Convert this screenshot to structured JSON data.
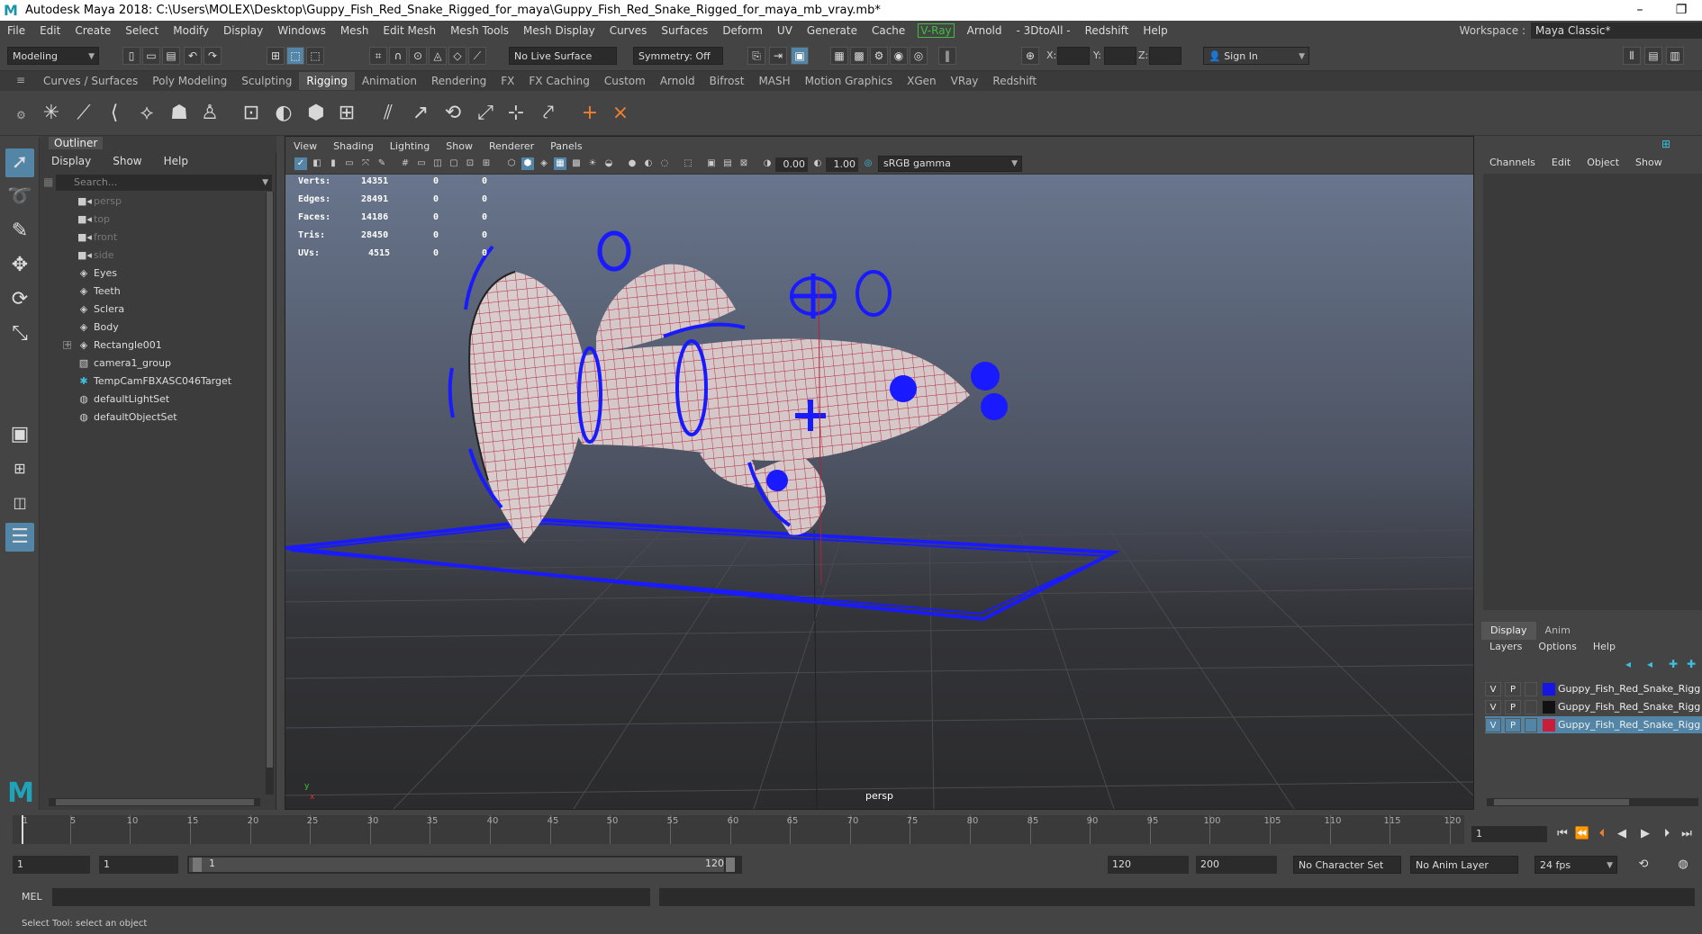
{
  "title": "Autodesk Maya 2018: C:\\Users\\MOLEX\\Desktop\\Guppy_Fish_Red_Snake_Rigged_for_maya\\Guppy_Fish_Red_Snake_Rigged_for_maya_mb_vray.mb*",
  "menus": [
    "File",
    "Edit",
    "Create",
    "Select",
    "Modify",
    "Display",
    "Windows",
    "Mesh",
    "Edit Mesh",
    "Mesh Tools",
    "Mesh Display",
    "Curves",
    "Surfaces",
    "Deform",
    "UV",
    "Generate",
    "Cache",
    "V-Ray",
    "Arnold",
    "- 3DtoAll -",
    "Redshift",
    "Help"
  ],
  "workspace": {
    "label": "Workspace :",
    "value": "Maya Classic*"
  },
  "status": {
    "mode": "Modeling",
    "live_surface": "No Live Surface",
    "symmetry": "Symmetry: Off",
    "x_label": "X:",
    "y_label": "Y:",
    "z_label": "Z:",
    "sign_in": "Sign In"
  },
  "shelf_tabs": [
    "Curves / Surfaces",
    "Poly Modeling",
    "Sculpting",
    "Rigging",
    "Animation",
    "Rendering",
    "FX",
    "FX Caching",
    "Custom",
    "Arnold",
    "Bifrost",
    "MASH",
    "Motion Graphics",
    "XGen",
    "VRay",
    "Redshift"
  ],
  "active_shelf_tab": "Rigging",
  "outliner": {
    "title": "Outliner",
    "menus": [
      "Display",
      "Show",
      "Help"
    ],
    "search_placeholder": "Search...",
    "items": [
      {
        "name": "persp",
        "icon": "camera-icon",
        "dim": true
      },
      {
        "name": "top",
        "icon": "camera-icon",
        "dim": true
      },
      {
        "name": "front",
        "icon": "camera-icon",
        "dim": true
      },
      {
        "name": "side",
        "icon": "camera-icon",
        "dim": true
      },
      {
        "name": "Eyes",
        "icon": "mesh-icon",
        "dim": false
      },
      {
        "name": "Teeth",
        "icon": "mesh-icon",
        "dim": false
      },
      {
        "name": "Sclera",
        "icon": "mesh-icon",
        "dim": false
      },
      {
        "name": "Body",
        "icon": "mesh-icon",
        "dim": false
      },
      {
        "name": "Rectangle001",
        "icon": "mesh-icon",
        "dim": false,
        "expandable": true
      },
      {
        "name": "camera1_group",
        "icon": "group-icon",
        "dim": false
      },
      {
        "name": "TempCamFBXASC046Target",
        "icon": "locator-icon",
        "dim": false
      },
      {
        "name": "defaultLightSet",
        "icon": "set-icon",
        "dim": false
      },
      {
        "name": "defaultObjectSet",
        "icon": "set-icon",
        "dim": false
      }
    ]
  },
  "viewport": {
    "menus": [
      "View",
      "Shading",
      "Lighting",
      "Show",
      "Renderer",
      "Panels"
    ],
    "exposure": "0.00",
    "gamma": "1.00",
    "color_space": "sRGB gamma",
    "camera": "persp",
    "stats": [
      {
        "label": "Verts:",
        "values": [
          "14351",
          "0",
          "0"
        ]
      },
      {
        "label": "Edges:",
        "values": [
          "28491",
          "0",
          "0"
        ]
      },
      {
        "label": "Faces:",
        "values": [
          "14186",
          "0",
          "0"
        ]
      },
      {
        "label": "Tris:",
        "values": [
          "28450",
          "0",
          "0"
        ]
      },
      {
        "label": "UVs:",
        "values": [
          "4515",
          "0",
          "0"
        ]
      }
    ]
  },
  "channel_box": {
    "menus": [
      "Channels",
      "Edit",
      "Object",
      "Show"
    ]
  },
  "layers": {
    "tabs": [
      "Display",
      "Anim"
    ],
    "menus": [
      "Layers",
      "Options",
      "Help"
    ],
    "rows": [
      {
        "v": "V",
        "p": "P",
        "color": "#1515e6",
        "name": "Guppy_Fish_Red_Snake_Rigg",
        "selected": false
      },
      {
        "v": "V",
        "p": "P",
        "color": "#111111",
        "name": "Guppy_Fish_Red_Snake_Rigg",
        "selected": false
      },
      {
        "v": "V",
        "p": "P",
        "color": "#c81e3c",
        "name": "Guppy_Fish_Red_Snake_Rigg",
        "selected": true
      }
    ]
  },
  "timeline": {
    "ticks": [
      "1",
      "5",
      "10",
      "15",
      "20",
      "25",
      "30",
      "35",
      "40",
      "45",
      "50",
      "55",
      "60",
      "65",
      "70",
      "75",
      "80",
      "85",
      "90",
      "95",
      "100",
      "105",
      "110",
      "115",
      "120"
    ],
    "current_frame": "1"
  },
  "range": {
    "start": "1",
    "playback_start": "1",
    "slider_start": "1",
    "slider_end": "120",
    "playback_end": "120",
    "end": "200",
    "character_set": "No Character Set",
    "anim_layer": "No Anim Layer",
    "fps": "24 fps"
  },
  "cmd": {
    "label": "MEL"
  },
  "help_line": "Select Tool: select an object",
  "colors": {
    "accent": "#5285a6",
    "control_blue": "#1a1aff",
    "wire_red": "#b4203a",
    "vray_green": "#3fbf3f"
  }
}
